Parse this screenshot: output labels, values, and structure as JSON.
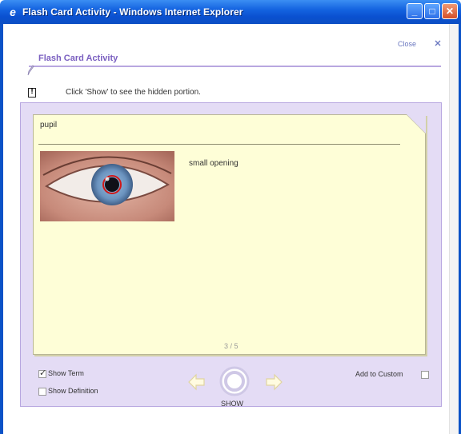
{
  "window": {
    "title": "Flash Card Activity - Windows Internet Explorer",
    "buttons": {
      "minimize": "_",
      "maximize": "□",
      "close": "✕"
    }
  },
  "header": {
    "close_label": "Close",
    "brand_title": "Flash Card Activity",
    "instruction": "Click 'Show' to see the hidden portion."
  },
  "card": {
    "term": "pupil",
    "definition": "small opening",
    "counter": "3 / 5"
  },
  "controls": {
    "show_term": {
      "label": "Show Term",
      "checked": true
    },
    "show_definition": {
      "label": "Show Definition",
      "checked": false
    },
    "add_to_custom": {
      "label": "Add to Custom",
      "checked": false
    },
    "show_label": "SHOW",
    "prev_icon": "arrow-left-icon",
    "next_icon": "arrow-right-icon"
  },
  "colors": {
    "titlebar": "#0a50d0",
    "accent_purple": "#7a5fc0",
    "panel_bg": "#e4dcf5",
    "card_bg": "#fefed7"
  }
}
